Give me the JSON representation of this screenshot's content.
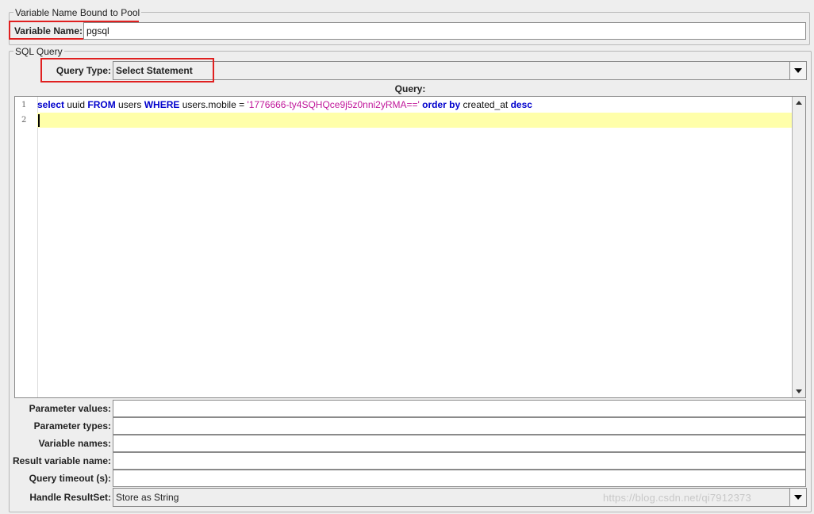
{
  "pool_section": {
    "legend": "Variable Name Bound to Pool",
    "variable_name_label": "Variable Name:",
    "variable_name_value": "pgsql"
  },
  "sql_section": {
    "legend": "SQL Query",
    "query_type_label": "Query Type:",
    "query_type_value": "Select Statement",
    "query_label": "Query:",
    "editor": {
      "line_numbers": [
        "1",
        "2"
      ],
      "line1": [
        {
          "t": "select",
          "k": "kw"
        },
        {
          "t": " uuid ",
          "k": "plain"
        },
        {
          "t": "FROM",
          "k": "kw"
        },
        {
          "t": " users ",
          "k": "plain"
        },
        {
          "t": "WHERE",
          "k": "kw"
        },
        {
          "t": " users.mobile = ",
          "k": "plain"
        },
        {
          "t": "'1776666-ty4SQHQce9j5z0nni2yRMA=='",
          "k": "str"
        },
        {
          "t": " ",
          "k": "plain"
        },
        {
          "t": "order by",
          "k": "kw"
        },
        {
          "t": " created_at ",
          "k": "plain"
        },
        {
          "t": "desc",
          "k": "kw"
        }
      ],
      "line2": ""
    },
    "fields": {
      "parameter_values_label": "Parameter values:",
      "parameter_values_value": "",
      "parameter_types_label": "Parameter types:",
      "parameter_types_value": "",
      "variable_names_label": "Variable names:",
      "variable_names_value": "",
      "result_variable_name_label": "Result variable name:",
      "result_variable_name_value": "",
      "query_timeout_label": "Query timeout (s):",
      "query_timeout_value": "",
      "handle_resultset_label": "Handle ResultSet:",
      "handle_resultset_value": "Store as String"
    }
  },
  "watermark": "https://blog.csdn.net/qi7912373",
  "colors": {
    "keyword": "#0000cc",
    "string": "#c0179a",
    "current_line": "#ffffaa",
    "highlight_box": "#e02020"
  }
}
